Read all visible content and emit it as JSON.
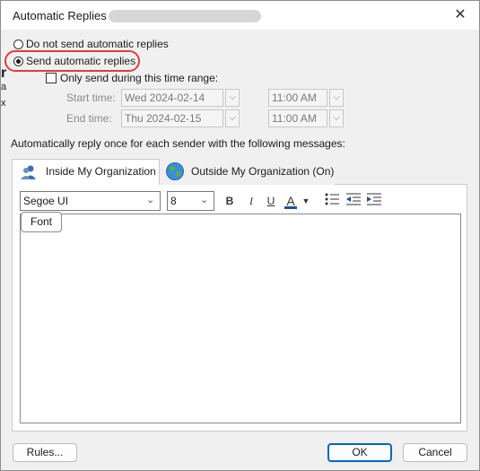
{
  "window": {
    "title": "Automatic Replies -",
    "close": "✕"
  },
  "options": {
    "do_not_send": "Do not send automatic replies",
    "send": "Send automatic replies",
    "only_time_range": "Only send during this time range:"
  },
  "time": {
    "start_label": "Start time:",
    "start_date": "Wed 2024-02-14",
    "start_time": "11:00 AM",
    "end_label": "End time:",
    "end_date": "Thu 2024-02-15",
    "end_time": "11:00 AM"
  },
  "instructions": "Automatically reply once for each sender with the following messages:",
  "tabs": [
    {
      "label": "Inside My Organization",
      "icon": "people-icon"
    },
    {
      "label": "Outside My Organization (On)",
      "icon": "globe-icon"
    }
  ],
  "toolbar": {
    "font": "Segoe UI",
    "size": "8",
    "bold": "B",
    "italic": "I",
    "underline": "U",
    "font_color": "A",
    "tooltip": "Font"
  },
  "buttons": {
    "rules": "Rules...",
    "ok": "OK",
    "cancel": "Cancel"
  },
  "background_text": {
    "r": "r",
    "a": "a",
    "x": "x"
  },
  "colors": {
    "highlight": "#e33b3b",
    "accent": "#0067c0"
  }
}
